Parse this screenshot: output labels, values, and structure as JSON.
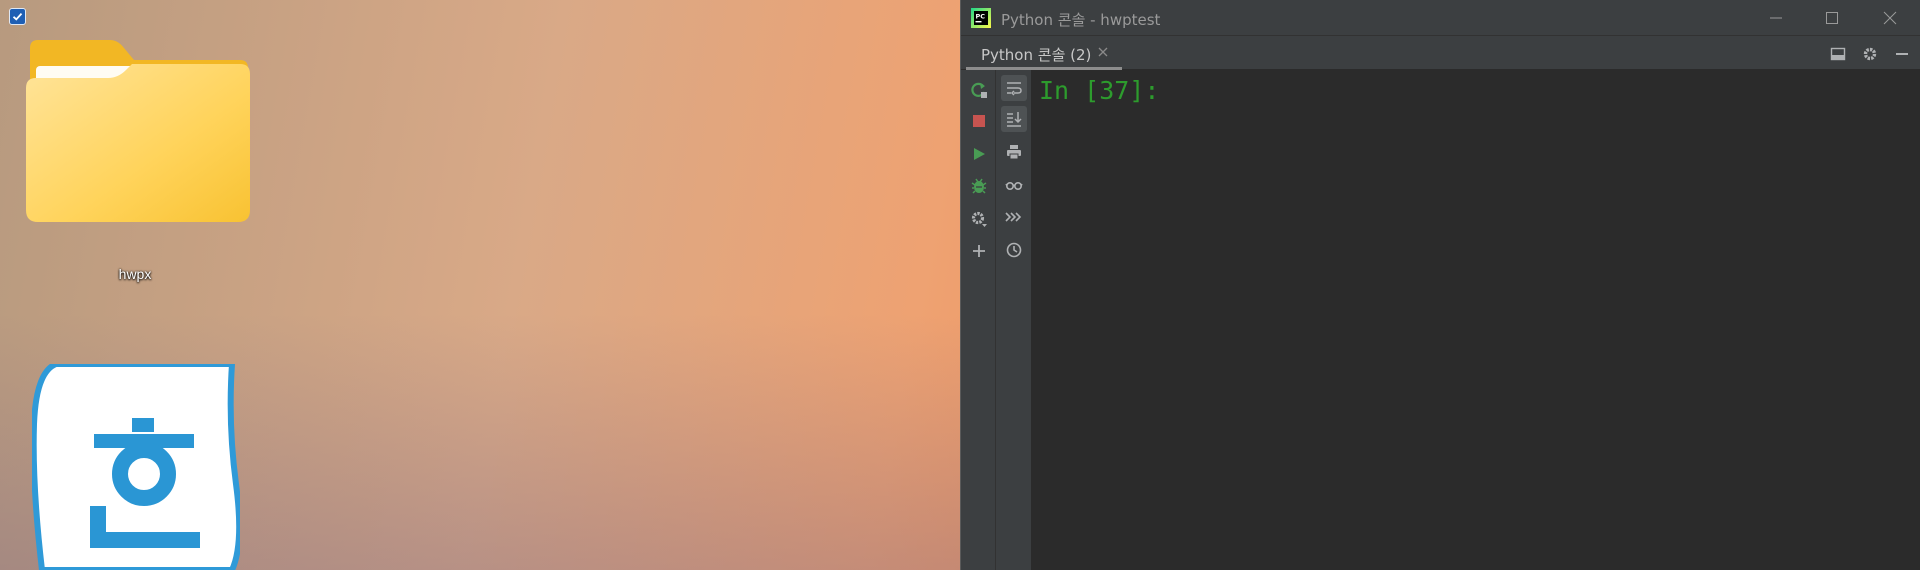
{
  "desktop": {
    "folder_label": "hwpx",
    "app_icon_glyph": "한"
  },
  "ide": {
    "window_title": "Python 콘솔 - hwptest",
    "tab_label": "Python 콘솔 (2)",
    "console_prompt": "In [37]:",
    "colors": {
      "editor_bg": "#2b2b2b",
      "toolbar_bg": "#3c3f41",
      "prompt_green": "#2d9c2d",
      "run_green": "#499c54",
      "stop_red": "#c75450"
    }
  }
}
